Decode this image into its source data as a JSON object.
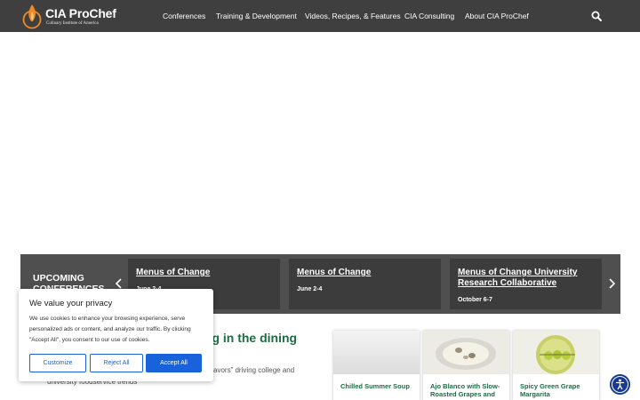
{
  "header": {
    "logo_title": "CIA ProChef",
    "logo_subtitle": "Culinary Institute of America",
    "nav": [
      "Conferences",
      "Training & Development",
      "Videos, Recipes, & Features",
      "CIA Consulting",
      "About CIA ProChef"
    ]
  },
  "conferences": {
    "heading": "UPCOMING CONFERENCES",
    "cards": [
      {
        "title": "Menus of Change",
        "date": "June 2-4"
      },
      {
        "title": "Menus of Change",
        "date": "June 2-4"
      },
      {
        "title": "Menus of Change University Research Collaborative",
        "date": "October 6-7"
      }
    ]
  },
  "article": {
    "headline_fragment": "ing in the dining",
    "text_fragment_1": "avors” driving college and",
    "text_fragment_2": "university foodservice trends"
  },
  "recipes": [
    {
      "label": "Chilled Summer Soup"
    },
    {
      "label": "Ajo Blanco with Slow-Roasted Grapes and"
    },
    {
      "label": "Spicy Green Grape Margarita"
    }
  ],
  "cookie": {
    "title": "We value your privacy",
    "text": "We use cookies to enhance your browsing experience, serve personalized ads or content, and analyze our traffic. By clicking \"Accept All\", you consent to our use of cookies.",
    "customize": "Customize",
    "reject": "Reject All",
    "accept": "Accept All"
  },
  "colors": {
    "header": "#3f3f3f",
    "band": "#4f4f4f",
    "accent_green": "#1e6b43",
    "button_blue": "#1863dc",
    "logo_orange": "#f08a24"
  },
  "icons": [
    "flame-logo-icon",
    "search-icon",
    "chevron-left-icon",
    "chevron-right-icon",
    "accessibility-icon"
  ]
}
